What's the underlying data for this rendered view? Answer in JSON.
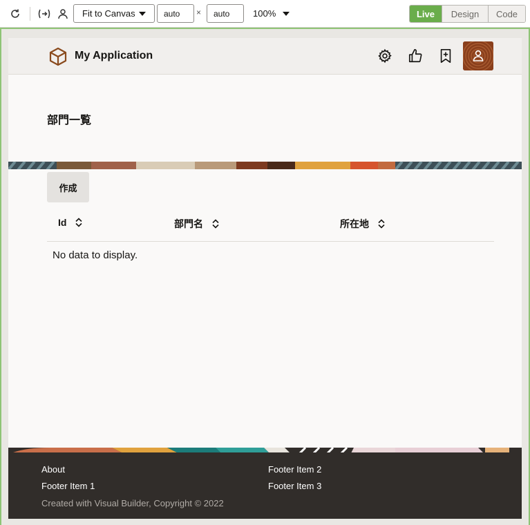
{
  "toolbar": {
    "fit_select": "Fit to Canvas",
    "width_value": "auto",
    "times": "×",
    "height_value": "auto",
    "zoom": "100%",
    "modes": [
      "Live",
      "Design",
      "Code"
    ],
    "active_mode": "Live"
  },
  "app": {
    "title": "My Application",
    "brand_color": "#8a4a1d"
  },
  "page": {
    "title": "部門一覧",
    "create_label": "作成",
    "columns": [
      "Id",
      "部門名",
      "所在地"
    ],
    "empty_message": "No data to display."
  },
  "footer": {
    "links_left": [
      "About",
      "Footer Item 1"
    ],
    "links_right": [
      "Footer Item 2",
      "Footer Item 3"
    ],
    "copyright": "Created with Visual Builder, Copyright © 2022"
  }
}
